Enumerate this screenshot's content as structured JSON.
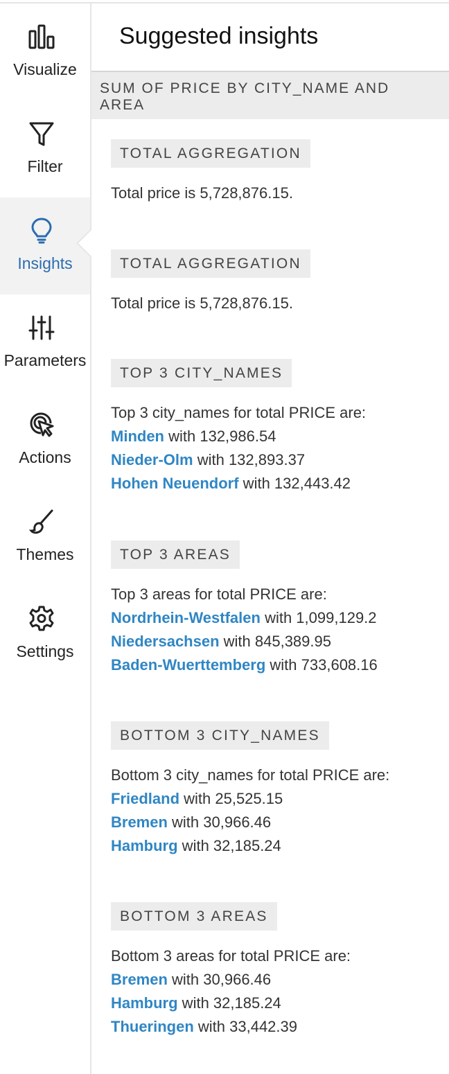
{
  "sidebar": {
    "items": [
      {
        "label": "Visualize",
        "icon": "bar-chart-icon",
        "active": false
      },
      {
        "label": "Filter",
        "icon": "funnel-icon",
        "active": false
      },
      {
        "label": "Insights",
        "icon": "lightbulb-icon",
        "active": true
      },
      {
        "label": "Parameters",
        "icon": "sliders-icon",
        "active": false
      },
      {
        "label": "Actions",
        "icon": "cursor-click-icon",
        "active": false
      },
      {
        "label": "Themes",
        "icon": "paintbrush-icon",
        "active": false
      },
      {
        "label": "Settings",
        "icon": "gear-icon",
        "active": false
      }
    ],
    "accent": "#2b6cb0"
  },
  "panel": {
    "title": "Suggested insights",
    "section_header": "SUM OF PRICE BY CITY_NAME AND AREA",
    "link_color": "#2f86c4",
    "insights": [
      {
        "tag": "TOTAL AGGREGATION",
        "text": "Total price is 5,728,876.15.",
        "items": []
      },
      {
        "tag": "TOTAL AGGREGATION",
        "text": "Total price is 5,728,876.15.",
        "items": []
      },
      {
        "tag": "TOP 3 CITY_NAMES",
        "text": "Top 3 city_names for total PRICE are:",
        "items": [
          {
            "name": "Minden",
            "suffix": " with 132,986.54"
          },
          {
            "name": "Nieder-Olm",
            "suffix": " with 132,893.37"
          },
          {
            "name": "Hohen Neuendorf",
            "suffix": " with 132,443.42"
          }
        ]
      },
      {
        "tag": "TOP 3 AREAS",
        "text": "Top 3 areas for total PRICE are:",
        "items": [
          {
            "name": "Nordrhein-Westfalen",
            "suffix": " with 1,099,129.2"
          },
          {
            "name": "Niedersachsen",
            "suffix": " with 845,389.95"
          },
          {
            "name": "Baden-Wuerttemberg",
            "suffix": " with 733,608.16"
          }
        ]
      },
      {
        "tag": "BOTTOM 3 CITY_NAMES",
        "text": "Bottom 3 city_names for total PRICE are:",
        "items": [
          {
            "name": "Friedland",
            "suffix": " with 25,525.15"
          },
          {
            "name": "Bremen",
            "suffix": " with 30,966.46"
          },
          {
            "name": "Hamburg",
            "suffix": " with 32,185.24"
          }
        ]
      },
      {
        "tag": "BOTTOM 3 AREAS",
        "text": "Bottom 3 areas for total PRICE are:",
        "items": [
          {
            "name": "Bremen",
            "suffix": " with 30,966.46"
          },
          {
            "name": "Hamburg",
            "suffix": " with 32,185.24"
          },
          {
            "name": "Thueringen",
            "suffix": " with 33,442.39"
          }
        ]
      }
    ]
  }
}
